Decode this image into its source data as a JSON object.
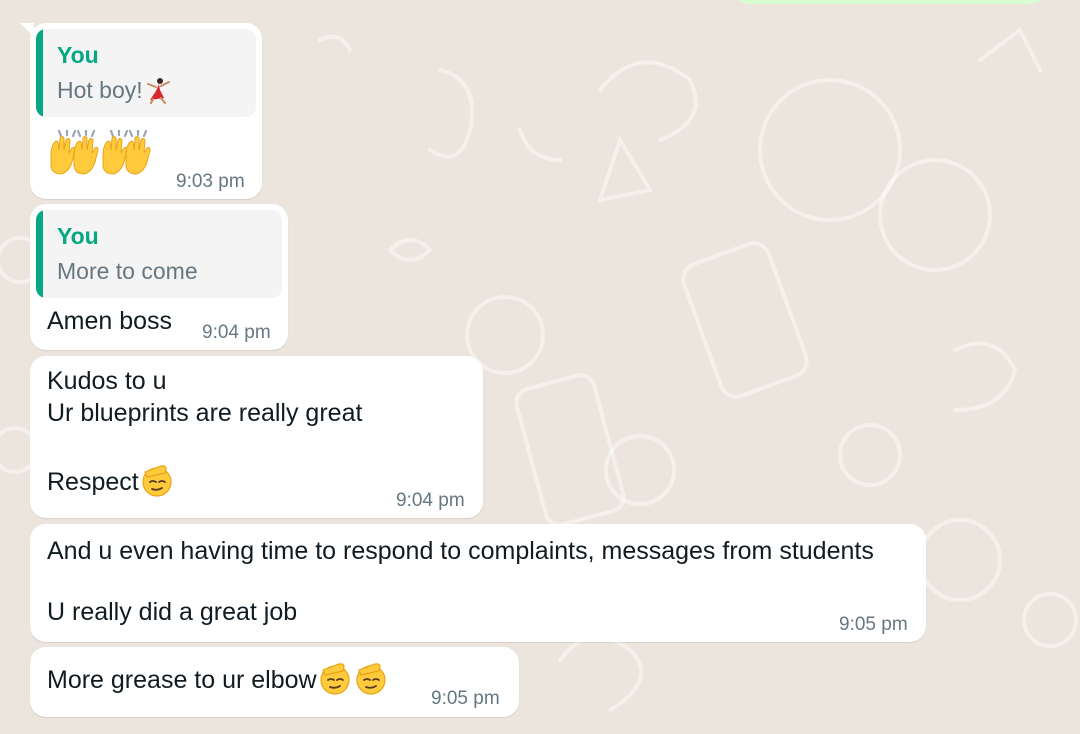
{
  "chat": {
    "messages": [
      {
        "quote": {
          "author": "You",
          "text": "Hot boy!"
        },
        "body_emoji": [
          "raising-hands",
          "raising-hands"
        ],
        "time": "9:03 pm"
      },
      {
        "quote": {
          "author": "You",
          "text": "More to come"
        },
        "text": "Amen boss",
        "time": "9:04 pm"
      },
      {
        "lines": [
          "Kudos to u",
          "Ur blueprints are really great",
          "",
          "Respect"
        ],
        "time": "9:04 pm"
      },
      {
        "lines": [
          "And u even having time to respond to complaints, messages from students",
          "",
          "U really did a great job"
        ],
        "time": "9:05 pm"
      },
      {
        "text": "More grease to ur elbow",
        "time": "9:05 pm"
      }
    ]
  },
  "icons": {
    "dancer": "dancer-emoji",
    "raising_hands": "raising-hands-emoji",
    "salute": "saluting-face-emoji"
  },
  "colors": {
    "background": "#ece5dd",
    "bubble": "#ffffff",
    "outgoing_bubble": "#d9fdd3",
    "quote_accent": "#06a884",
    "quote_bg": "#f3f4f3",
    "text": "#111b21",
    "meta": "#667781"
  }
}
